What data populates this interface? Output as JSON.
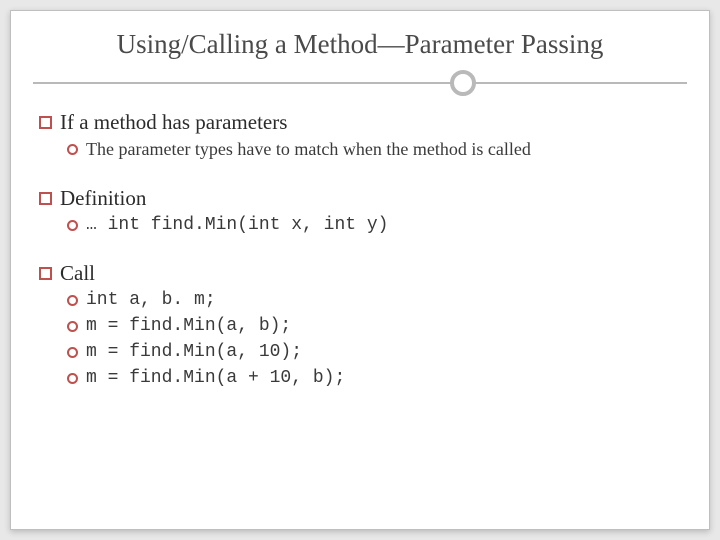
{
  "title": "Using/Calling a Method—Parameter Passing",
  "sections": [
    {
      "heading": "If a method has parameters",
      "items": [
        {
          "text": "The parameter types have to match when the method is called",
          "code": false
        }
      ]
    },
    {
      "heading": "Definition",
      "items": [
        {
          "text": "… int find.Min(int x, int y)",
          "code": true
        }
      ]
    },
    {
      "heading": "Call",
      "items": [
        {
          "text": "int a, b. m;",
          "code": true
        },
        {
          "text": "m = find.Min(a, b);",
          "code": true
        },
        {
          "text": "m = find.Min(a, 10);",
          "code": true
        },
        {
          "text": "m = find.Min(a + 10, b);",
          "code": true
        }
      ]
    }
  ]
}
